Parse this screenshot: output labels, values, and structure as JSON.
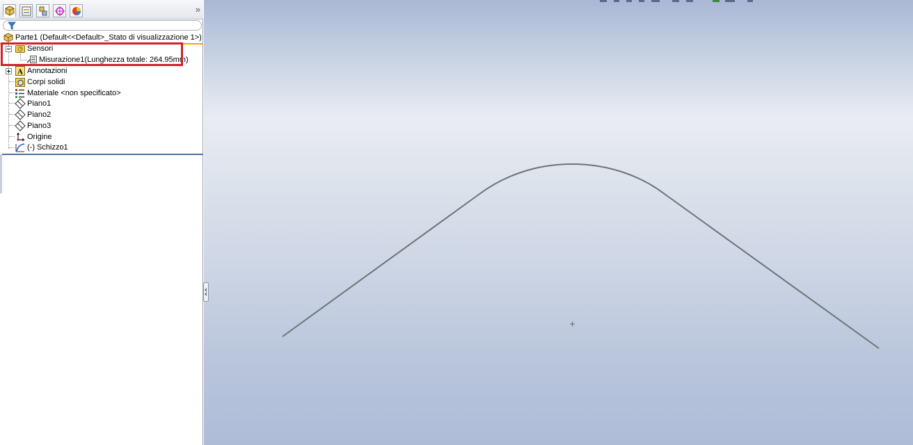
{
  "feature_manager": {
    "tabs": [
      "feature-manager",
      "property-manager",
      "configuration-manager",
      "dimxpert-manager",
      "display-manager"
    ],
    "collapse_glyph": "»",
    "filter_icon": "filter-icon",
    "root": {
      "label": "Parte1  (Default<<Default>_Stato di visualizzazione 1>)"
    },
    "items": [
      {
        "label": "Sensori",
        "icon": "sensor-icon",
        "expander": "−"
      },
      {
        "label": "Misurazione1(Lunghezza totale: 264.95mm)",
        "icon": "measure-icon"
      },
      {
        "label": "Annotazioni",
        "icon": "annotation-icon",
        "expander": "+"
      },
      {
        "label": "Corpi solidi",
        "icon": "solid-bodies-icon"
      },
      {
        "label": "Materiale <non specificato>",
        "icon": "material-icon"
      },
      {
        "label": "Piano1",
        "icon": "plane-icon"
      },
      {
        "label": "Piano2",
        "icon": "plane-icon"
      },
      {
        "label": "Piano3",
        "icon": "plane-icon"
      },
      {
        "label": "Origine",
        "icon": "origin-icon"
      },
      {
        "label": "(-) Schizzo1",
        "icon": "sketch-icon"
      }
    ]
  },
  "highlight_color": "#d2202e",
  "viewport": {
    "sketch_color": "#6e7278",
    "origin_marker": "+"
  }
}
